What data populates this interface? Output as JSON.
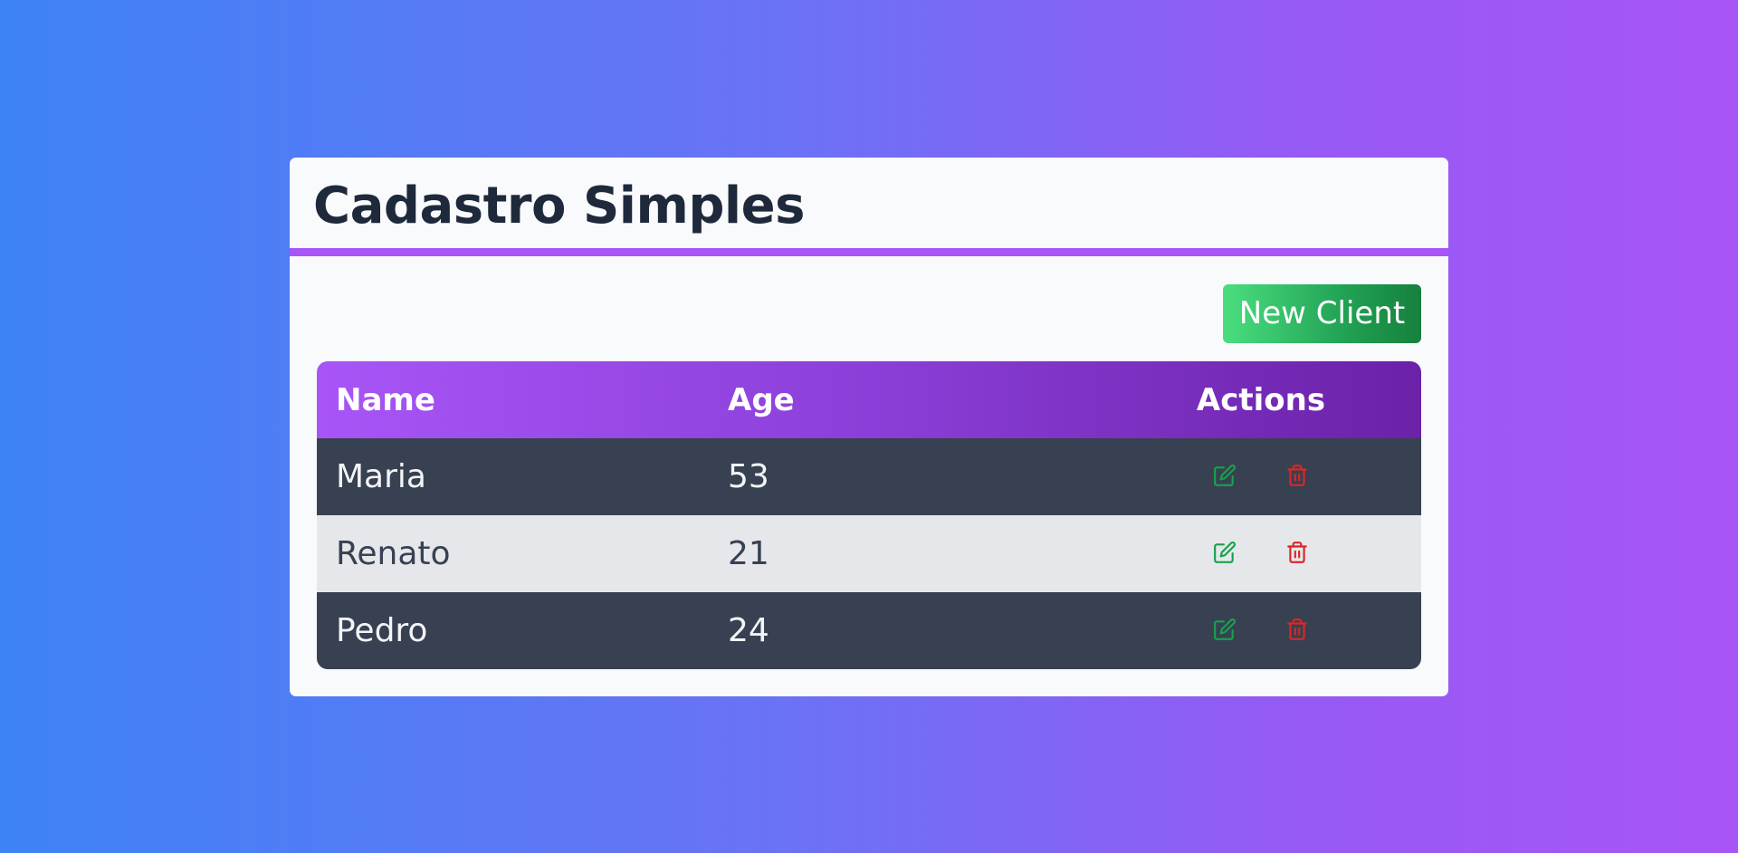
{
  "page": {
    "title": "Cadastro Simples"
  },
  "toolbar": {
    "new_client_label": "New Client"
  },
  "table": {
    "columns": [
      "Name",
      "Age",
      "Actions"
    ],
    "rows": [
      {
        "name": "Maria",
        "age": "53"
      },
      {
        "name": "Renato",
        "age": "21"
      },
      {
        "name": "Pedro",
        "age": "24"
      }
    ],
    "action_icons": [
      "edit-icon",
      "trash-icon"
    ]
  },
  "colors": {
    "accent": "#a855f7",
    "header_gradient_start": "#a855f7",
    "header_gradient_end": "#6b21a8",
    "button_green": "#22c55e",
    "edit_icon": "#16a34a",
    "delete_icon": "#dc2626",
    "row_dark": "#374151",
    "row_light": "#e5e7eb"
  }
}
